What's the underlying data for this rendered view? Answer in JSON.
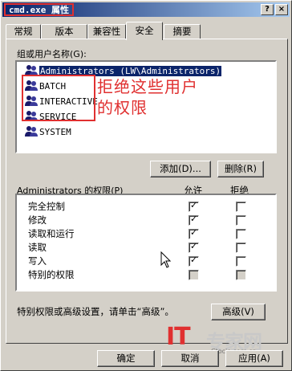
{
  "window": {
    "title": "cmd.exe 属性",
    "help_glyph": "?",
    "close_glyph": "×"
  },
  "tabs": [
    {
      "label": "常规",
      "active": false
    },
    {
      "label": "版本",
      "active": false
    },
    {
      "label": "兼容性",
      "active": false
    },
    {
      "label": "安全",
      "active": true
    },
    {
      "label": "摘要",
      "active": false
    }
  ],
  "users": {
    "label": "组或用户名称(G):",
    "items": [
      {
        "name": "Administrators (LW\\Administrators)",
        "selected": true
      },
      {
        "name": "BATCH",
        "selected": false
      },
      {
        "name": "INTERACTIVE",
        "selected": false
      },
      {
        "name": "SERVICE",
        "selected": false
      },
      {
        "name": "SYSTEM",
        "selected": false
      }
    ],
    "icon": "users-group-icon"
  },
  "annotation": {
    "text": "拒绝这些用户的权限",
    "color": "#e03030"
  },
  "buttons": {
    "add": "添加(D)...",
    "remove": "删除(R)",
    "advanced": "高级(V)",
    "ok": "确定",
    "cancel": "取消",
    "apply": "应用(A)"
  },
  "permissions": {
    "label": "Administrators 的权限(P)",
    "allow_header": "允许",
    "deny_header": "拒绝",
    "rows": [
      {
        "name": "完全控制",
        "allow": true,
        "deny": false,
        "disabled": false
      },
      {
        "name": "修改",
        "allow": true,
        "deny": false,
        "disabled": false
      },
      {
        "name": "读取和运行",
        "allow": true,
        "deny": false,
        "disabled": false
      },
      {
        "name": "读取",
        "allow": true,
        "deny": false,
        "disabled": false
      },
      {
        "name": "写入",
        "allow": true,
        "deny": false,
        "disabled": false
      },
      {
        "name": "特别的权限",
        "allow": false,
        "deny": false,
        "disabled": true
      }
    ]
  },
  "advanced_hint": "特别权限或高级设置，请单击“高级”。",
  "watermark": {
    "brand_it": "IT",
    "brand_cn": "专家网",
    "url": "Ctocio.com.cn"
  },
  "colors": {
    "face": "#d4d0c8",
    "title_start": "#0a246a",
    "title_end": "#a6caf0",
    "highlight": "#e03030"
  }
}
